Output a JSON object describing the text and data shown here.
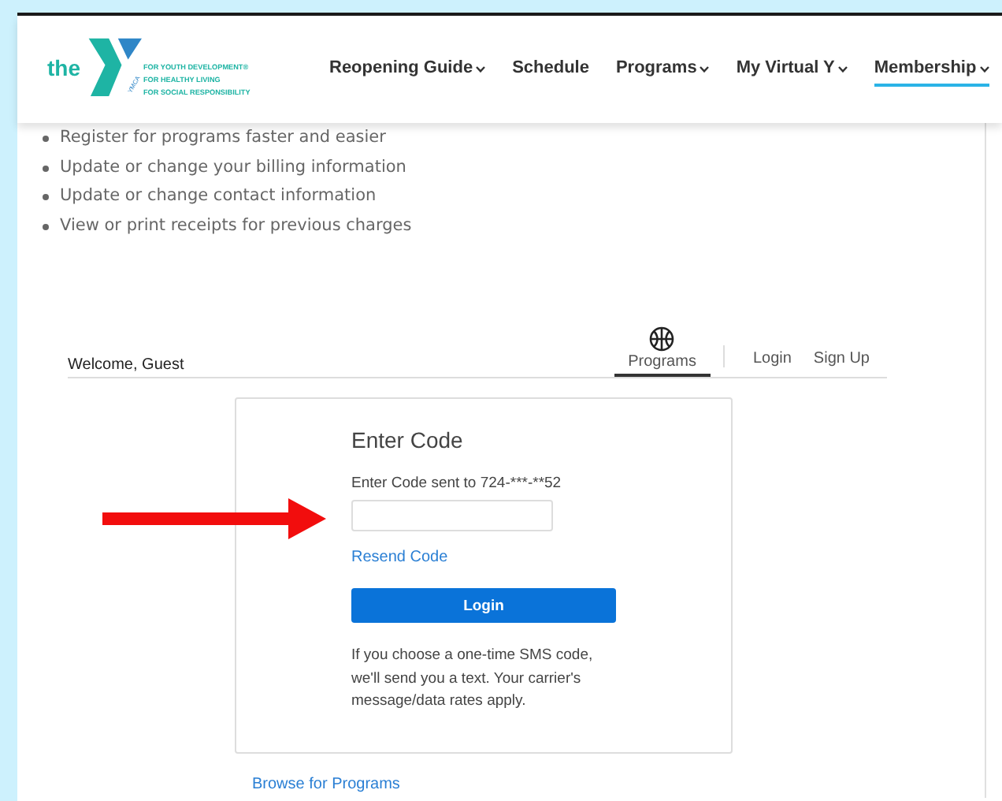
{
  "logo": {
    "word": "the",
    "mark": "YMCA",
    "tagline": [
      "FOR YOUTH DEVELOPMENT®",
      "FOR HEALTHY LIVING",
      "FOR SOCIAL RESPONSIBILITY"
    ]
  },
  "nav": [
    {
      "label": "Reopening Guide",
      "dropdown": true,
      "selected": false
    },
    {
      "label": "Schedule",
      "dropdown": false,
      "selected": false
    },
    {
      "label": "Programs",
      "dropdown": true,
      "selected": false
    },
    {
      "label": "My Virtual Y",
      "dropdown": true,
      "selected": false
    },
    {
      "label": "Membership",
      "dropdown": true,
      "selected": true
    }
  ],
  "benefits": [
    "Register for programs faster and easier",
    "Update or change your billing information",
    "Update or change contact information",
    "View or print receipts for previous charges"
  ],
  "account_bar": {
    "welcome": "Welcome, Guest",
    "tabs": [
      {
        "label": "Programs",
        "kind": "icon",
        "selected": true
      },
      {
        "label": "Login",
        "kind": "text",
        "selected": false
      },
      {
        "label": "Sign Up",
        "kind": "text",
        "selected": false
      }
    ]
  },
  "code_form": {
    "title": "Enter Code",
    "label": "Enter Code sent to 724-***-**52",
    "resend": "Resend Code",
    "button": "Login",
    "note": "If you choose a one-time SMS code, we'll send you a text. Your carrier's message/data rates apply."
  },
  "browse_link": "Browse for Programs"
}
